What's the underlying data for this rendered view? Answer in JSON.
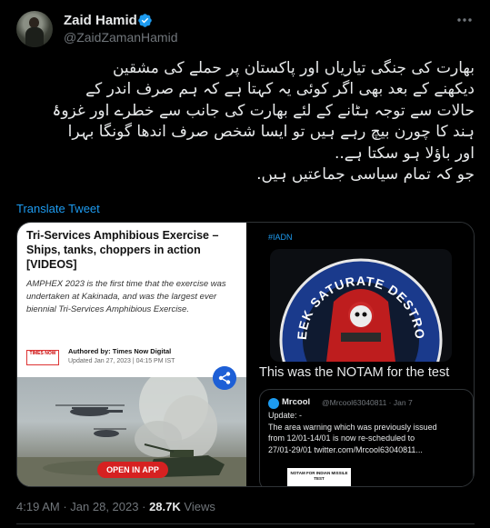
{
  "author": {
    "name": "Zaid Hamid",
    "handle": "@ZaidZamanHamid"
  },
  "tweet": {
    "lines": [
      "بھارت کی جنگی تیاریاں اور پاکستان پر حملے کی مشقین",
      "دیکھنے کے بعد بھی اگر کوئی یہ کہتا ہے کہ ہم صرف اندر کے",
      "حالات سے توجہ ہٹانے کے لئے بھارت کی جانب سے خطرے اور غزوۂ",
      "ہند کا چورن بیچ رہے ہیں  تو ایسا شخص صرف اندھا گونگا بہرا",
      "اور باؤلا ہو سکتا ہے..",
      "جو کہ تمام سیاسی جماعتیں ہیں."
    ],
    "translate_label": "Translate Tweet"
  },
  "media_left": {
    "title": "Tri-Services Amphibious Exercise – Ships, tanks, choppers in action [VIDEOS]",
    "subtitle": "AMPHEX 2023 is the first time that the exercise was undertaken at Kakinada, and was the largest ever biennial Tri-Services Amphibious Exercise.",
    "logo_text": "TIMES NOW",
    "authored_by": "Authored by: Times Now Digital",
    "updated": "Updated Jan 27, 2023 | 04:15 PM IST",
    "open_app_label": "OPEN IN APP"
  },
  "media_right": {
    "hashtag": "#IADN",
    "emblem_text": "SEEK SATURATE DESTROY",
    "caption": "This was the NOTAM for the test",
    "quoted": {
      "name": "Mrcool",
      "handle": "@Mrcool63040811 · Jan 7",
      "lines": [
        "Update: -",
        "The area warning which was previously issued",
        "from 12/01-14/01 is now re-scheduled to",
        "27/01-29/01 twitter.com/Mrcool63040811..."
      ],
      "image_text": "NOTAM FOR INDIAN MISSILE TEST"
    }
  },
  "meta": {
    "time": "4:19 AM",
    "date": "Jan 28, 2023",
    "separator": "·",
    "views_count": "28.7K",
    "views_label": "Views"
  },
  "colors": {
    "background": "#000000",
    "text": "#e7e9ea",
    "muted": "#71767b",
    "accent": "#1d9bf0"
  }
}
